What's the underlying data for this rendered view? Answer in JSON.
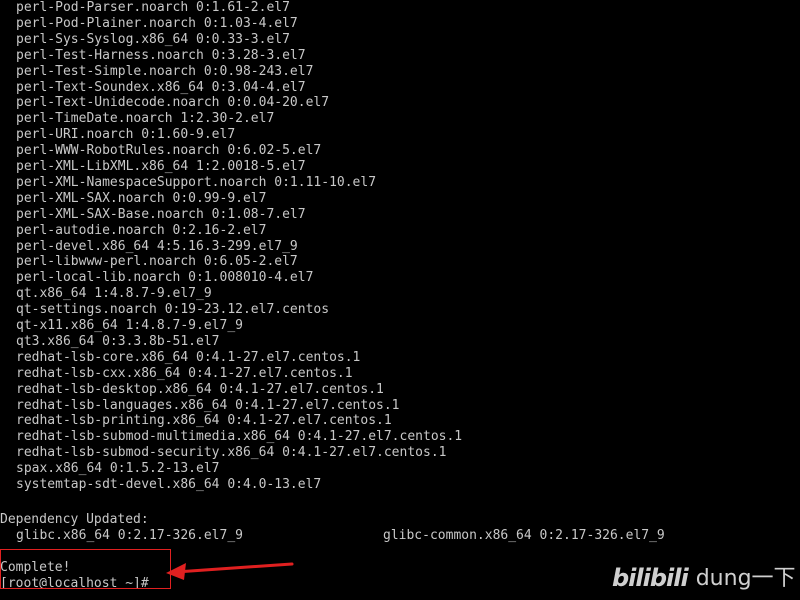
{
  "terminal": {
    "package_lines": [
      "perl-Pod-Parser.noarch 0:1.61-2.el7",
      "perl-Pod-Plainer.noarch 0:1.03-4.el7",
      "perl-Sys-Syslog.x86_64 0:0.33-3.el7",
      "perl-Test-Harness.noarch 0:3.28-3.el7",
      "perl-Test-Simple.noarch 0:0.98-243.el7",
      "perl-Text-Soundex.x86_64 0:3.04-4.el7",
      "perl-Text-Unidecode.noarch 0:0.04-20.el7",
      "perl-TimeDate.noarch 1:2.30-2.el7",
      "perl-URI.noarch 0:1.60-9.el7",
      "perl-WWW-RobotRules.noarch 0:6.02-5.el7",
      "perl-XML-LibXML.x86_64 1:2.0018-5.el7",
      "perl-XML-NamespaceSupport.noarch 0:1.11-10.el7",
      "perl-XML-SAX.noarch 0:0.99-9.el7",
      "perl-XML-SAX-Base.noarch 0:1.08-7.el7",
      "perl-autodie.noarch 0:2.16-2.el7",
      "perl-devel.x86_64 4:5.16.3-299.el7_9",
      "perl-libwww-perl.noarch 0:6.05-2.el7",
      "perl-local-lib.noarch 0:1.008010-4.el7",
      "qt.x86_64 1:4.8.7-9.el7_9",
      "qt-settings.noarch 0:19-23.12.el7.centos",
      "qt-x11.x86_64 1:4.8.7-9.el7_9",
      "qt3.x86_64 0:3.3.8b-51.el7",
      "redhat-lsb-core.x86_64 0:4.1-27.el7.centos.1",
      "redhat-lsb-cxx.x86_64 0:4.1-27.el7.centos.1",
      "redhat-lsb-desktop.x86_64 0:4.1-27.el7.centos.1",
      "redhat-lsb-languages.x86_64 0:4.1-27.el7.centos.1",
      "redhat-lsb-printing.x86_64 0:4.1-27.el7.centos.1",
      "redhat-lsb-submod-multimedia.x86_64 0:4.1-27.el7.centos.1",
      "redhat-lsb-submod-security.x86_64 0:4.1-27.el7.centos.1",
      "spax.x86_64 0:1.5.2-13.el7",
      "systemtap-sdt-devel.x86_64 0:4.0-13.el7"
    ],
    "dependency_updated_header": "Dependency Updated:",
    "dependency_updated_items": [
      "glibc.x86_64 0:2.17-326.el7_9",
      "glibc-common.x86_64 0:2.17-326.el7_9"
    ],
    "complete_text": "Complete!",
    "prompt_text": "[root@localhost ~]#"
  },
  "annotation": {
    "color": "#e02020"
  },
  "watermark": {
    "logo": "bilibili",
    "text": "dung一下"
  },
  "colors": {
    "background": "#000000",
    "foreground": "#c8c8c8"
  }
}
